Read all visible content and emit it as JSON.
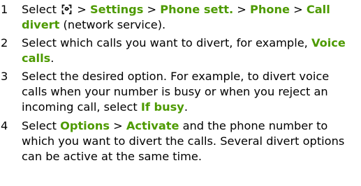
{
  "colors": {
    "keyword": "#4d9a00",
    "text": "#000000"
  },
  "steps": [
    {
      "number": "1",
      "parts": {
        "t1": "Select ",
        "icon": "menu-key-icon",
        "t2": " > ",
        "k1": "Settings",
        "t3": " > ",
        "k2": "Phone sett.",
        "t4": " > ",
        "k3": "Phone",
        "t5": " > ",
        "k4": "Call divert",
        "t6": " (network service)."
      }
    },
    {
      "number": "2",
      "parts": {
        "t1": "Select which calls you want to divert, for example, ",
        "k1": "Voice calls",
        "t2": "."
      }
    },
    {
      "number": "3",
      "parts": {
        "t1": "Select the desired option. For example, to divert voice calls when your number is busy or when you reject an incoming call, select ",
        "k1": "If busy",
        "t2": "."
      }
    },
    {
      "number": "4",
      "parts": {
        "t1": "Select ",
        "k1": "Options",
        "t2": " > ",
        "k2": "Activate",
        "t3": " and the phone number to which you want to divert the calls. Several divert options can be active at the same time."
      }
    }
  ]
}
